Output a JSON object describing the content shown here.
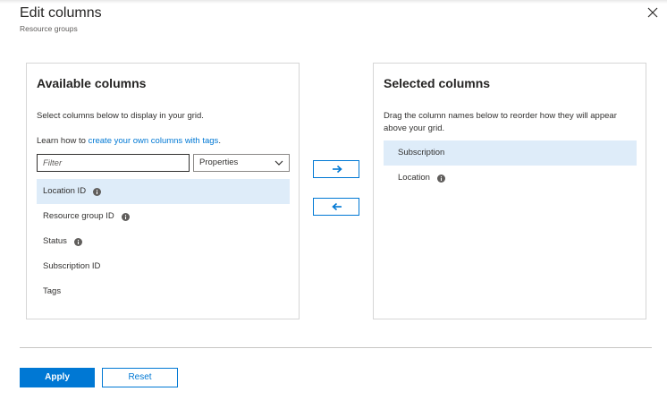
{
  "header": {
    "title": "Edit columns",
    "subtitle": "Resource groups"
  },
  "available": {
    "title": "Available columns",
    "description": "Select columns below to display in your grid.",
    "learn_prefix": "Learn how to ",
    "learn_link": "create your own columns with tags",
    "learn_suffix": ".",
    "filter_placeholder": "Filter",
    "filter_value": "",
    "dropdown_selected": "Properties",
    "items": [
      {
        "label": "Location ID",
        "info": true,
        "selected": true
      },
      {
        "label": "Resource group ID",
        "info": true,
        "selected": false
      },
      {
        "label": "Status",
        "info": true,
        "selected": false
      },
      {
        "label": "Subscription ID",
        "info": false,
        "selected": false
      },
      {
        "label": "Tags",
        "info": false,
        "selected": false
      }
    ]
  },
  "selected": {
    "title": "Selected columns",
    "description": "Drag the column names below to reorder how they will appear above your grid.",
    "items": [
      {
        "label": "Subscription",
        "info": false,
        "selected": true
      },
      {
        "label": "Location",
        "info": true,
        "selected": false
      }
    ]
  },
  "footer": {
    "apply_label": "Apply",
    "reset_label": "Reset"
  },
  "colors": {
    "accent": "#0078d4",
    "selected_row": "#deecf9"
  },
  "icons": {
    "close": "close-icon",
    "info": "info-icon",
    "add": "arrow-right-icon",
    "remove": "arrow-left-icon",
    "dropdown": "chevron-down-icon"
  }
}
